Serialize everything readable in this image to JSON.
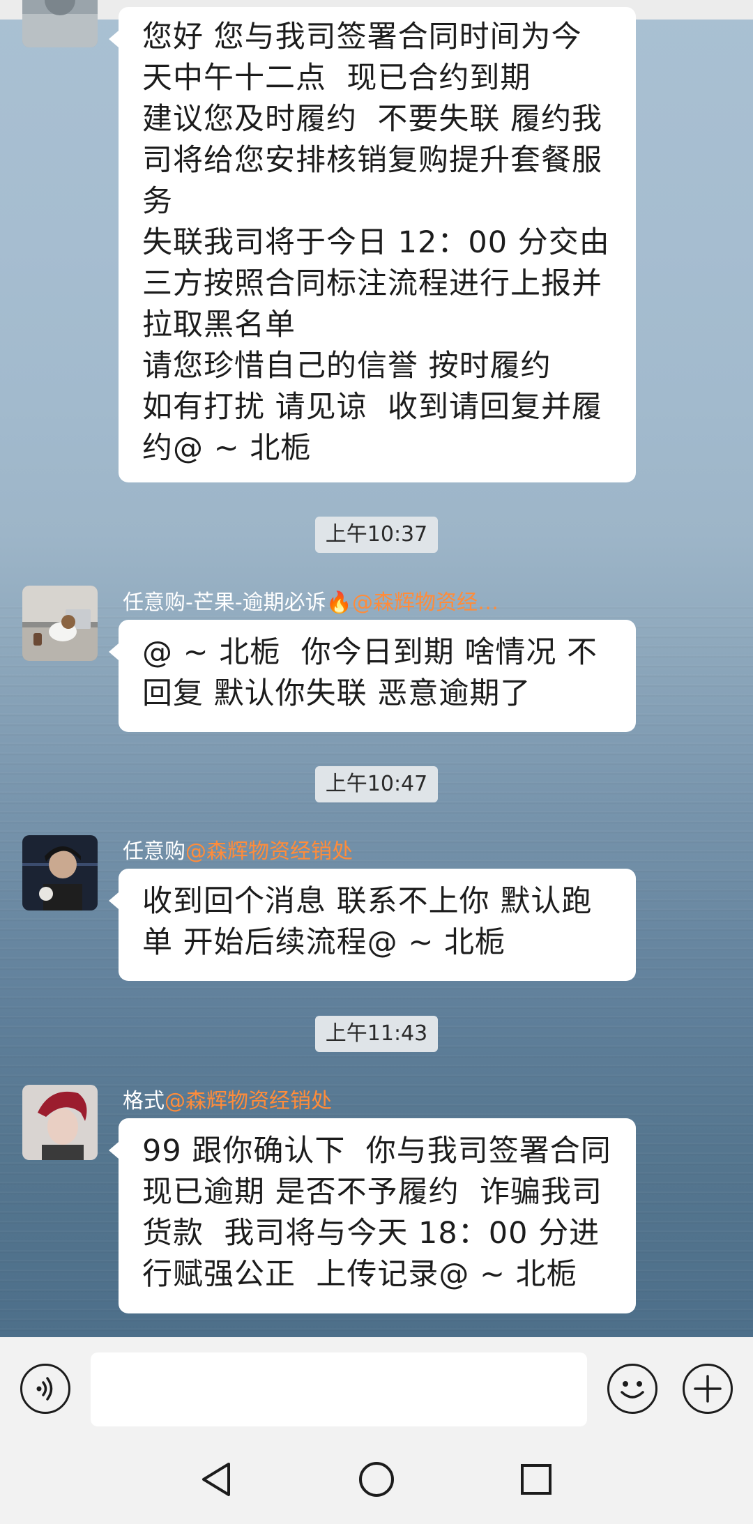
{
  "messages": {
    "m1": {
      "lines": [
        "您好 您与我司签署合同时间为今天中午十二点  现已合约到期",
        "建议您及时履约  不要失联 履约我司将给您安排核销复购提升套餐服务",
        "失联我司将于今日 12：00 分交由三方按照合同标注流程进行上报并拉取黑名单",
        "请您珍惜自己的信誉 按时履约   如有打扰 请见谅  收到请回复并履约@ ~ 北栀"
      ]
    },
    "t2": "上午10:37",
    "m2": {
      "sender": "任意购-芒果-逾期必诉",
      "fire": "🔥",
      "tag": "@森辉物资经…",
      "text": "@ ~ 北栀  你今日到期 啥情况 不回复 默认你失联 恶意逾期了"
    },
    "t3": "上午10:47",
    "m3": {
      "sender": "任意购",
      "tag": "@森辉物资经销处",
      "text": "收到回个消息 联系不上你 默认跑单 开始后续流程@ ~ 北栀"
    },
    "t4": "上午11:43",
    "m4": {
      "sender": "格式",
      "tag": "@森辉物资经销处",
      "text": "99 跟你确认下  你与我司签署合同现已逾期 是否不予履约  诈骗我司货款  我司将与今天 18：00 分进行赋强公正  上传记录@ ~ 北栀"
    }
  },
  "input": {
    "value": ""
  },
  "icons": {
    "voice": "voice-icon",
    "emoji": "emoji-icon",
    "add": "add-icon",
    "back": "nav-back-icon",
    "home": "nav-home-icon",
    "recents": "nav-recents-icon"
  }
}
